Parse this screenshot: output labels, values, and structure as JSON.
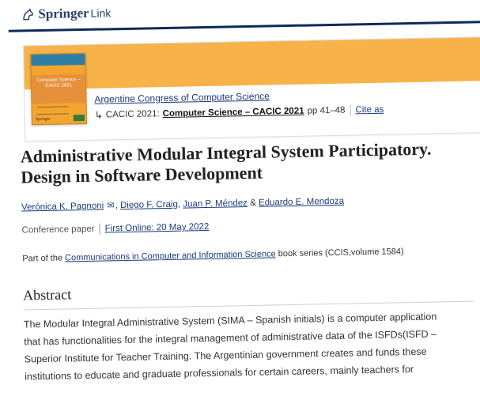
{
  "brand": {
    "name": "Springer",
    "suffix": "Link"
  },
  "book": {
    "series_link": "Argentine Congress of Computer Science",
    "conference": "CACIC 2021:",
    "volume_title": "Computer Science – CACIC 2021",
    "pages": "pp 41–48",
    "cite": "Cite as",
    "cover": {
      "title": "Computer Science – CACIC 2021",
      "publisher": "Springer"
    }
  },
  "article": {
    "title": "Administrative Modular Integral System Participatory. Design in Software Development",
    "authors": [
      "Verónica K. Pagnoni",
      "Diego F. Craig",
      "Juan P. Méndez",
      "Eduardo E. Mendoza"
    ],
    "author_sep": ",",
    "author_and": "&",
    "type": "Conference paper",
    "first_online": "First Online: 20 May 2022",
    "part_of_prefix": "Part of the",
    "series_name": "Communications in Computer and Information Science",
    "part_of_suffix": "book series (CCIS,volume 1584)"
  },
  "abstract": {
    "heading": "Abstract",
    "lines": [
      "The Modular Integral Administrative System (SIMA – Spanish initials) is a computer application",
      "that has functionalities for the integral management of administrative data of the ISFDs(ISFD –",
      "Superior Institute for Teacher Training. The Argentinian government creates and funds these",
      "institutions to educate and graduate professionals for certain careers, mainly teachers for"
    ]
  },
  "colors": {
    "accent_band": "#f8b24a",
    "navy": "#0c2a59",
    "link": "#1b3a7a"
  }
}
